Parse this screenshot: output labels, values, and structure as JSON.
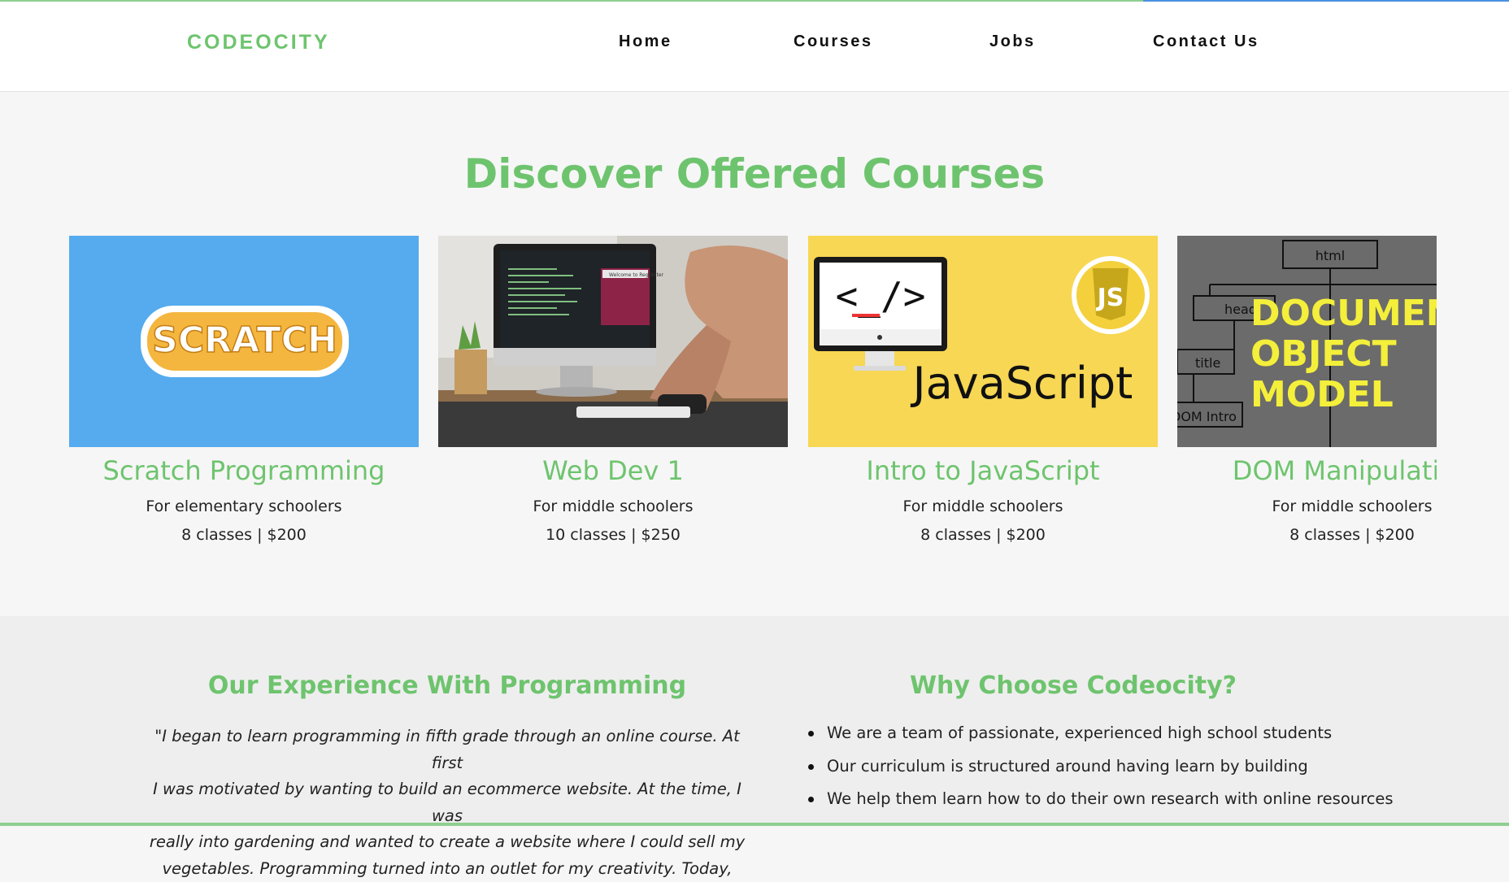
{
  "header": {
    "logo": "CODEOCITY",
    "nav": [
      "Home",
      "Courses",
      "Jobs",
      "Contact Us"
    ]
  },
  "courses": {
    "title": "Discover Offered Courses",
    "items": [
      {
        "name": "Scratch Programming",
        "audience": "For elementary schoolers",
        "price": "8 classes | $200",
        "image": "scratch-logo",
        "image_text": "SCRATCH"
      },
      {
        "name": "Web Dev 1",
        "audience": "For middle schoolers",
        "price": "10 classes | $250",
        "image": "person-at-computer-photo",
        "image_text": "Welcome to RegWriter"
      },
      {
        "name": "Intro to JavaScript",
        "audience": "For middle schoolers",
        "price": "8 classes | $200",
        "image": "javascript-monitor",
        "image_text": "JavaScript",
        "badge": "JS",
        "code_glyph": "<_/>"
      },
      {
        "name": "DOM Manipulation",
        "audience": "For middle schoolers",
        "price": "8 classes | $200",
        "image": "dom-tree-diagram",
        "image_text": "DOCUMENT OBJECT MODEL",
        "tree_labels": [
          "html",
          "head",
          "title",
          "DOM Intro"
        ]
      }
    ],
    "scroll_position": 0.94
  },
  "experience": {
    "title": "Our Experience With Programming",
    "quote_lines": [
      "\"I began to learn programming in fifth grade through an online course. At first",
      "I was motivated by wanting to build an ecommerce website. At the time, I was",
      "really into gardening and wanted to create a website where I could sell my",
      "vegetables. Programming turned into an outlet for my creativity. Today,"
    ]
  },
  "why": {
    "title": "Why Choose Codeocity?",
    "items": [
      "We are a team of passionate, experienced high school students",
      "Our curriculum is structured around having learn by building",
      "We help them learn how to do their own research with online resources"
    ]
  },
  "colors": {
    "accent": "#6ec46e",
    "scratch_bg": "#55abee",
    "js_bg": "#f7d753",
    "dom_bg": "#6b6b6b"
  }
}
